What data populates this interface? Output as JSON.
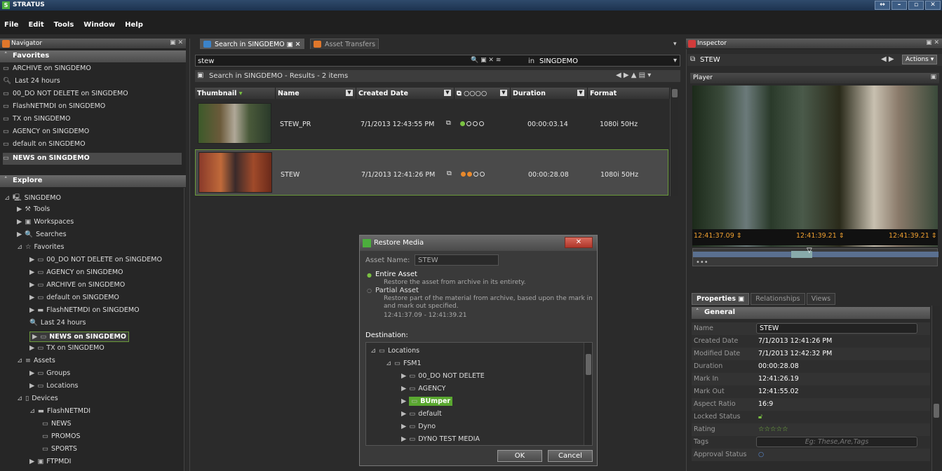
{
  "app": {
    "title": "STRATUS"
  },
  "menu": [
    "File",
    "Edit",
    "Tools",
    "Window",
    "Help"
  ],
  "navigator": {
    "title": "Navigator",
    "favorites_header": "Favorites",
    "favorites": [
      "ARCHIVE on SINGDEMO",
      "Last 24 hours",
      "00_DO NOT DELETE on SINGDEMO",
      "FlashNETMDI on SINGDEMO",
      "TX on SINGDEMO",
      "AGENCY on SINGDEMO",
      "default on SINGDEMO",
      "NEWS on SINGDEMO"
    ],
    "explore_header": "Explore",
    "tree": [
      {
        "label": "SINGDEMO",
        "indent": 0,
        "exp": "⊿",
        "ico": "🖳"
      },
      {
        "label": "Tools",
        "indent": 1,
        "exp": "▶",
        "ico": "⚒"
      },
      {
        "label": "Workspaces",
        "indent": 1,
        "exp": "▶",
        "ico": "▣"
      },
      {
        "label": "Searches",
        "indent": 1,
        "exp": "▶",
        "ico": "🔍"
      },
      {
        "label": "Favorites",
        "indent": 1,
        "exp": "⊿",
        "ico": "☆"
      },
      {
        "label": "00_DO NOT DELETE on SINGDEMO",
        "indent": 2,
        "exp": "▶",
        "ico": "▭"
      },
      {
        "label": "AGENCY on SINGDEMO",
        "indent": 2,
        "exp": "▶",
        "ico": "▭"
      },
      {
        "label": "ARCHIVE on SINGDEMO",
        "indent": 2,
        "exp": "▶",
        "ico": "▭"
      },
      {
        "label": "default on SINGDEMO",
        "indent": 2,
        "exp": "▶",
        "ico": "▭"
      },
      {
        "label": "FlashNETMDI on SINGDEMO",
        "indent": 2,
        "exp": "▶",
        "ico": "▬"
      },
      {
        "label": "Last 24 hours",
        "indent": 2,
        "exp": "",
        "ico": "🔍"
      },
      {
        "label": "NEWS on SINGDEMO",
        "indent": 2,
        "exp": "▶",
        "ico": "▭"
      },
      {
        "label": "TX on SINGDEMO",
        "indent": 2,
        "exp": "▶",
        "ico": "▭"
      },
      {
        "label": "Assets",
        "indent": 1,
        "exp": "⊿",
        "ico": "≡"
      },
      {
        "label": "Groups",
        "indent": 2,
        "exp": "▶",
        "ico": "▭"
      },
      {
        "label": "Locations",
        "indent": 2,
        "exp": "▶",
        "ico": "▭"
      },
      {
        "label": "Devices",
        "indent": 1,
        "exp": "⊿",
        "ico": "▯"
      },
      {
        "label": "FlashNETMDI",
        "indent": 2,
        "exp": "⊿",
        "ico": "▬"
      },
      {
        "label": "NEWS",
        "indent": 3,
        "exp": "",
        "ico": "▭"
      },
      {
        "label": "PROMOS",
        "indent": 3,
        "exp": "",
        "ico": "▭"
      },
      {
        "label": "SPORTS",
        "indent": 3,
        "exp": "",
        "ico": "▭"
      },
      {
        "label": "FTPMDI",
        "indent": 2,
        "exp": "▶",
        "ico": "▣"
      }
    ]
  },
  "tabs": {
    "search": "Search in SINGDEMO",
    "transfers": "Asset Transfers"
  },
  "search": {
    "query": "stew",
    "in": "in",
    "scope": "SINGDEMO",
    "results": "Search in SINGDEMO - Results - 2 items"
  },
  "columns": [
    "Thumbnail",
    "Name",
    "Created Date",
    "",
    "Duration",
    "Format"
  ],
  "rows": [
    {
      "name": "STEW_PR",
      "created": "7/1/2013 12:43:55 PM",
      "duration": "00:00:03.14",
      "format": "1080i 50Hz",
      "dot1": "#7ac142"
    },
    {
      "name": "STEW",
      "created": "7/1/2013 12:41:26 PM",
      "duration": "00:00:28.08",
      "format": "1080i 50Hz",
      "dot1": "#e8892c"
    }
  ],
  "dialog": {
    "title": "Restore Media",
    "asset_name_label": "Asset Name:",
    "asset_name": "STEW",
    "entire": "Entire Asset",
    "entire_desc": "Restore the asset from archive in its entirety.",
    "partial": "Partial Asset",
    "partial_desc": "Restore part of the material from archive, based upon the mark in and mark out specified.",
    "range": "12:41:37.09 - 12:41:39.21",
    "destination": "Destination:",
    "tree": [
      {
        "label": "Locations",
        "indent": 0,
        "exp": "⊿"
      },
      {
        "label": "FSM1",
        "indent": 1,
        "exp": "⊿"
      },
      {
        "label": "00_DO NOT DELETE",
        "indent": 2,
        "exp": "▶"
      },
      {
        "label": "AGENCY",
        "indent": 2,
        "exp": "▶"
      },
      {
        "label": "BUmper",
        "indent": 2,
        "exp": "▶"
      },
      {
        "label": "default",
        "indent": 2,
        "exp": "▶"
      },
      {
        "label": "Dyno",
        "indent": 2,
        "exp": "▶"
      },
      {
        "label": "DYNO TEST MEDIA",
        "indent": 2,
        "exp": "▶"
      }
    ],
    "ok": "OK",
    "cancel": "Cancel"
  },
  "inspector": {
    "title": "Inspector",
    "asset": "STEW",
    "actions": "Actions",
    "player": "Player",
    "tc_in": "12:41:37.09",
    "tc_cur": "12:41:39.21",
    "tc_out": "12:41:39.21",
    "tabs": [
      "Properties",
      "Relationships",
      "Views"
    ],
    "general": "General",
    "props": [
      {
        "k": "Name",
        "v": "STEW"
      },
      {
        "k": "Created Date",
        "v": "7/1/2013 12:41:26 PM"
      },
      {
        "k": "Modified Date",
        "v": "7/1/2013 12:42:32 PM"
      },
      {
        "k": "Duration",
        "v": "00:00:28.08"
      },
      {
        "k": "Mark In",
        "v": "12:41:26.19"
      },
      {
        "k": "Mark Out",
        "v": "12:41:55.02"
      },
      {
        "k": "Aspect Ratio",
        "v": "16:9"
      },
      {
        "k": "Locked Status",
        "v": ""
      },
      {
        "k": "Rating",
        "v": "☆☆☆☆☆"
      },
      {
        "k": "Tags",
        "v": ""
      },
      {
        "k": "Approval Status",
        "v": ""
      }
    ],
    "tags_placeholder": "Eg: These,Are,Tags"
  }
}
